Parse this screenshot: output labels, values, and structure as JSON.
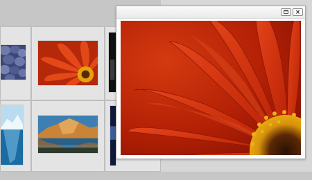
{
  "window": {
    "buttons": [
      "maximize",
      "close"
    ]
  },
  "thumbnails": [
    {
      "name": "pebbles",
      "colors": [
        "#6e79a8",
        "#37406e"
      ]
    },
    {
      "name": "orange-daisy",
      "colors": [
        "#e0441a",
        "#9a1a06"
      ]
    },
    {
      "name": "dark-photo",
      "colors": [
        "#111111",
        "#444444"
      ]
    },
    {
      "name": "iceberg",
      "colors": [
        "#cfe8f6",
        "#1a6aa0"
      ]
    },
    {
      "name": "desert-lake",
      "colors": [
        "#d48a3e",
        "#2f6b98"
      ]
    },
    {
      "name": "dark-blue-photo",
      "colors": [
        "#0f1838",
        "#3d5d96"
      ]
    }
  ],
  "colors": {
    "flower_red": "#c42608",
    "flower_dark": "#7a1002",
    "flower_center": "#e2a30b"
  }
}
